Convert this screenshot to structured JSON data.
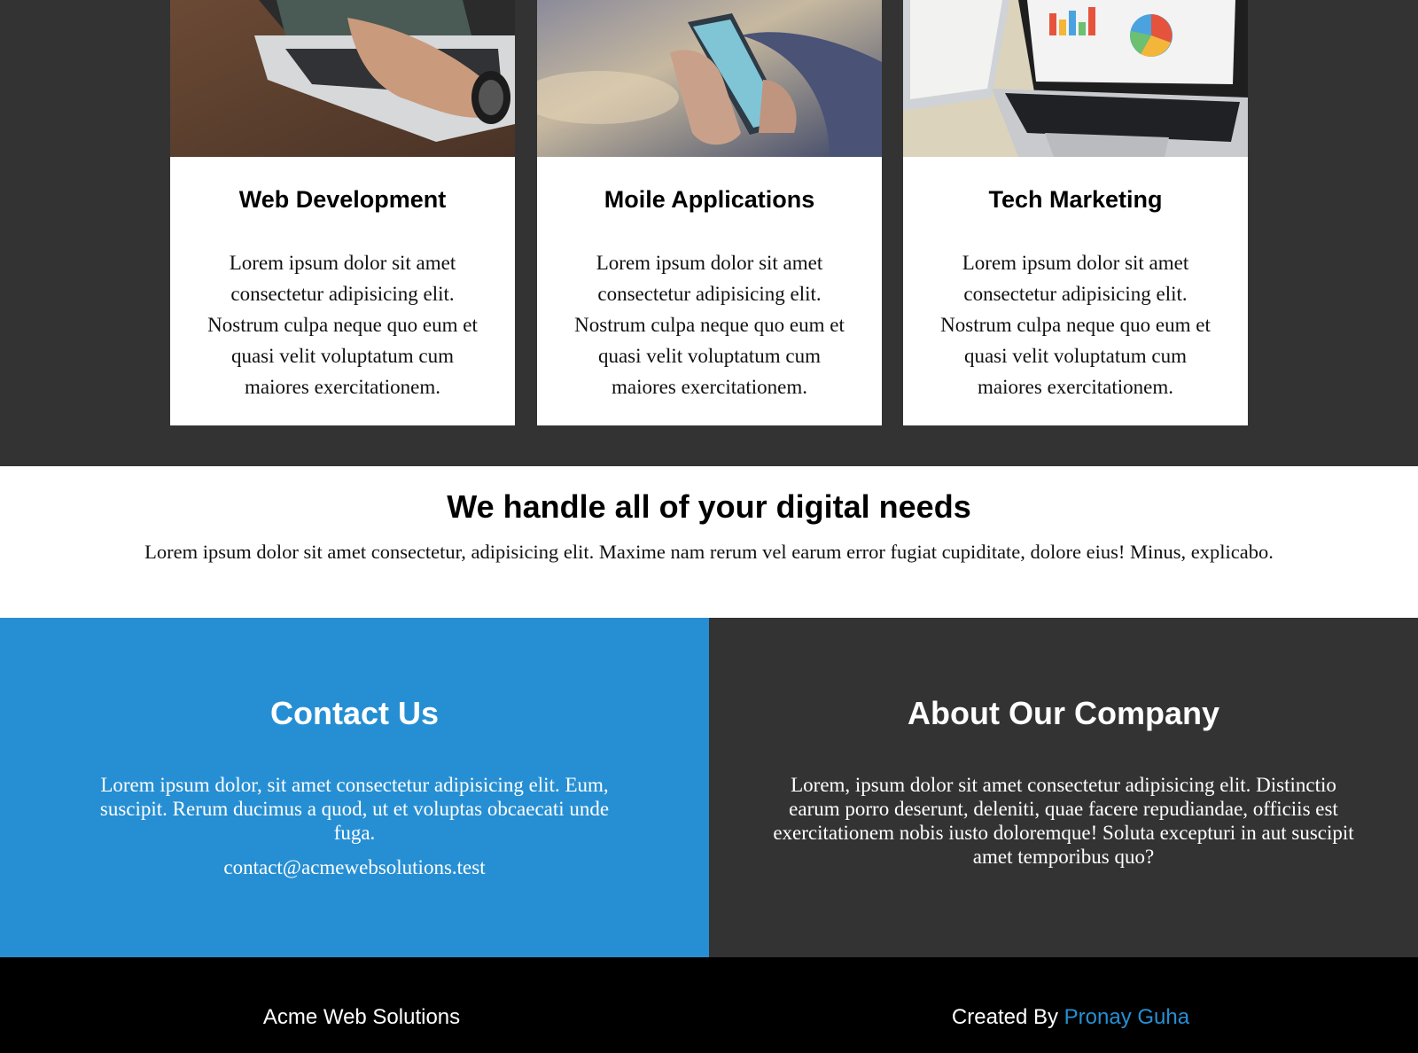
{
  "services": {
    "cards": [
      {
        "image": "laptop-typing-photo",
        "title": "Web Development",
        "text": "Lorem ipsum dolor sit amet consectetur adipisicing elit. Nostrum culpa neque quo eum et quasi velit voluptatum cum maiores exercitationem."
      },
      {
        "image": "smartphone-hand-photo",
        "title": "Moile Applications",
        "text": "Lorem ipsum dolor sit amet consectetur adipisicing elit. Nostrum culpa neque quo eum et quasi velit voluptatum cum maiores exercitationem."
      },
      {
        "image": "laptop-charts-photo",
        "title": "Tech Marketing",
        "text": "Lorem ipsum dolor sit amet consectetur adipisicing elit. Nostrum culpa neque quo eum et quasi velit voluptatum cum maiores exercitationem."
      }
    ]
  },
  "needs": {
    "title": "We handle all of your digital needs",
    "text": "Lorem ipsum dolor sit amet consectetur, adipisicing elit. Maxime nam rerum vel earum error fugiat cupiditate, dolore eius! Minus, explicabo."
  },
  "contact": {
    "title": "Contact Us",
    "text": "Lorem ipsum dolor, sit amet consectetur adipisicing elit. Eum, suscipit. Rerum ducimus a quod, ut et voluptas obcaecati unde fuga.",
    "email": "contact@acmewebsolutions.test"
  },
  "about": {
    "title": "About Our Company",
    "text": "Lorem, ipsum dolor sit amet consectetur adipisicing elit. Distinctio earum porro deserunt, deleniti, quae facere repudiandae, officiis est exercitationem nobis iusto doloremque! Soluta excepturi in aut suscipit amet temporibus quo?"
  },
  "footer": {
    "brand": "Acme Web Solutions",
    "credit_prefix": "Created By",
    "credit_name": "Pronay Guha"
  },
  "colors": {
    "dark_bg": "#333333",
    "accent_blue": "#268fd3",
    "footer_bg": "#000000"
  }
}
